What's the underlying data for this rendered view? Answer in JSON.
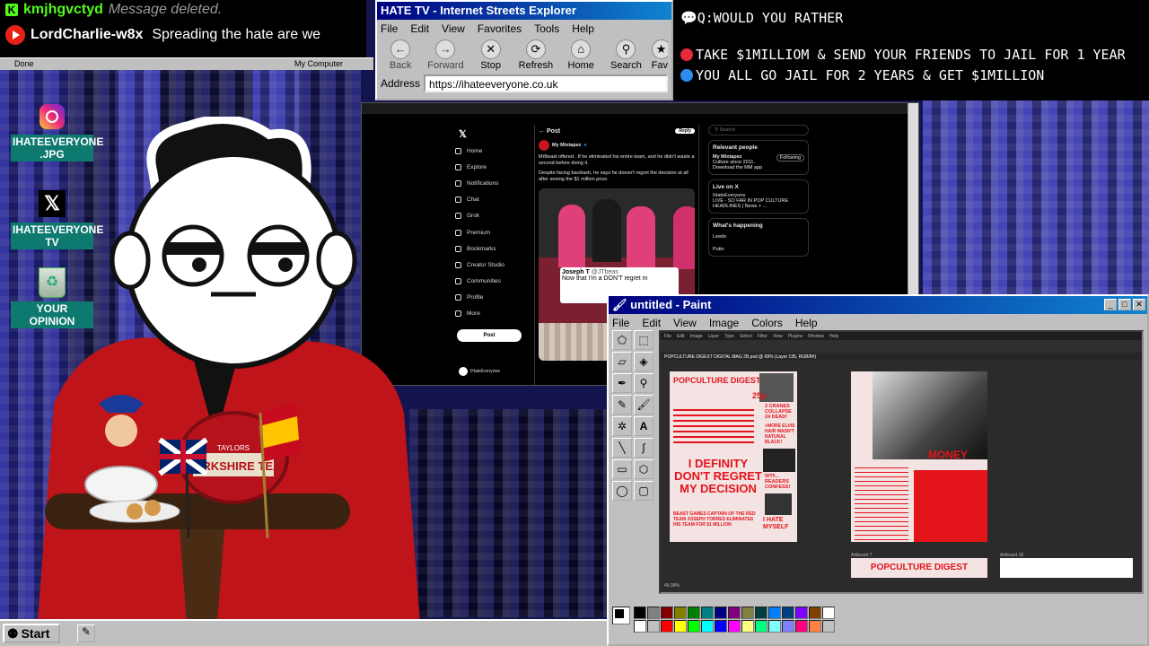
{
  "chat": {
    "messages": [
      {
        "user": "kmjhgvctyd",
        "text": "Message deleted.",
        "platform": "kick",
        "user_color": "#53fc18"
      },
      {
        "user": "LordCharlie-w8x",
        "text": "Spreading the hate are we",
        "platform": "youtube",
        "user_color": "#ffffff"
      }
    ],
    "status_left": "Done",
    "status_right": "My Computer"
  },
  "desktop": {
    "icons": [
      {
        "label": "IHATEEVERYONE .JPG",
        "icon": "instagram-icon"
      },
      {
        "label": "IHATEEVERYONE TV",
        "icon": "x-logo-icon"
      },
      {
        "label": "YOUR OPINION",
        "icon": "recycle-bin-icon"
      }
    ]
  },
  "browser": {
    "title": "HATE TV - Internet Streets Explorer",
    "menu": [
      "File",
      "Edit",
      "View",
      "Favorites",
      "Tools",
      "Help"
    ],
    "toolbar": [
      "Back",
      "Forward",
      "Stop",
      "Refresh",
      "Home",
      "Search",
      "Fav"
    ],
    "address_label": "Address",
    "url": "https://ihateeveryone.co.uk"
  },
  "question": {
    "prompt": "Q:WOULD YOU RATHER",
    "option_a": "TAKE $1MILLIOM & SEND YOUR FRIENDS TO JAIL FOR 1 YEAR",
    "option_b": "YOU ALL GO JAIL FOR 2 YEARS & GET $1MILLION",
    "option_a_color": "#e8293a",
    "option_b_color": "#2d8cf0"
  },
  "twitter": {
    "nav": [
      "Home",
      "Explore",
      "Notifications",
      "Chat",
      "Grok",
      "Premium",
      "Bookmarks",
      "Creator Studio",
      "Communities",
      "Profile",
      "More"
    ],
    "post_button": "Post",
    "header": "Post",
    "reply": "Reply",
    "author": "My Mixtapez",
    "body_1": "MrBeast offered                    . If he eliminated his entire team, and he didn't waste a second before doing it.",
    "body_2": "Despite facing backlash, he says he doesn't regret the decision at all after seeing the $1 million prize.",
    "quote_name": "Joseph T",
    "quote_handle": "@JTbeas",
    "quote_text": "Now that I'm a DON'T regret m",
    "search": "Search",
    "relevant_title": "Relevant people",
    "relevant_name": "My Mixtapez",
    "relevant_desc": "Culture since 2011. Download the MM app",
    "following": "Following",
    "live_title": "Live on X",
    "live_user": "IHateEveryone",
    "live_text": "LIVE - SO FAR IN POP CULTURE HEADLINES | News + ...",
    "happening": "What's happening",
    "trends": [
      "Leeds",
      "Putin"
    ],
    "footer_user": "IHateEveryone"
  },
  "paint": {
    "title": "untitled - Paint",
    "menu": [
      "File",
      "Edit",
      "View",
      "Image",
      "Colors",
      "Help"
    ],
    "ps_menu": [
      "File",
      "Edit",
      "Image",
      "Layer",
      "Type",
      "Select",
      "Filter",
      "View",
      "Plugins",
      "Window",
      "Help"
    ],
    "doc_tab": "POPCULTURE DIGEST DIGITAL MAG 2B.psd @ 69% (Layer 135, RGB/8#)",
    "mag": {
      "masthead": "POPCULTURE DIGEST",
      "headline": "I DEFINITY DON'T REGRET MY DECISION",
      "side_1": "2 CRANES COLLAPSE 24 DEAD!",
      "side_2": "+MORE ELVIS HAIR WASN'T NATURAL BLACK!",
      "side_3": "WTF... READERS CONFESS!",
      "side_4": "I HATE MYSELF",
      "sub": "BEAST GAMES CAPTAIN OF THE RED TEAM JOSEPH TORRES ELIMINATES HIS TEAM FOR $1 MILLION",
      "price": "25p",
      "word": "MONEY",
      "artboard_1": "Artboard 7",
      "artboard_2": "Artboard 18",
      "bottom_masthead": "POPCULTURE DIGEST"
    },
    "zoom": "45.99%",
    "palette": [
      "#000000",
      "#808080",
      "#800000",
      "#808000",
      "#008000",
      "#008080",
      "#000080",
      "#800080",
      "#808040",
      "#004040",
      "#0080ff",
      "#004080",
      "#8000ff",
      "#804000",
      "#ffffff",
      "#ffffff",
      "#c0c0c0",
      "#ff0000",
      "#ffff00",
      "#00ff00",
      "#00ffff",
      "#0000ff",
      "#ff00ff",
      "#ffff80",
      "#00ff80",
      "#80ffff",
      "#8080ff",
      "#ff0080",
      "#ff8040",
      "#c0c0c0"
    ]
  },
  "taskbar": {
    "start": "Start"
  },
  "props": {
    "tea_label": "YORKSHIRE TEA",
    "tea_top": "TAYLORS"
  }
}
